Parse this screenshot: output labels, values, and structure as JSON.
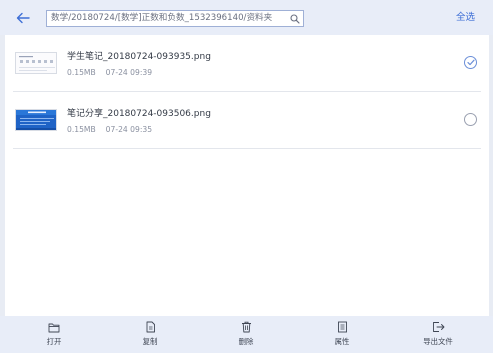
{
  "header": {
    "path": "数学/20180724/[数学]正数和负数_1532396140/资料夹",
    "select_all": "全选"
  },
  "files": [
    {
      "name": "学生笔记_20180724-093935.png",
      "size": "0.15MB",
      "time": "07-24 09:39",
      "checked": true
    },
    {
      "name": "笔记分享_20180724-093506.png",
      "size": "0.15MB",
      "time": "07-24 09:35",
      "checked": false
    }
  ],
  "toolbar": {
    "open": "打开",
    "copy": "复制",
    "delete": "删除",
    "properties": "属性",
    "export": "导出文件"
  },
  "colors": {
    "accent": "#3e6fd6",
    "bar_bg": "#e8edf8",
    "check_color": "#6b8fd8"
  }
}
